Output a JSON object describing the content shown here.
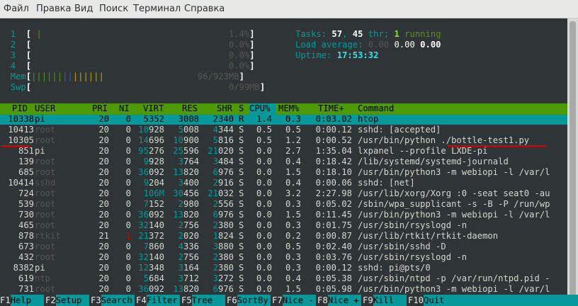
{
  "menu": [
    "Файл",
    "Правка",
    "Вид",
    "Поиск",
    "Терминал",
    "Справка"
  ],
  "cpus": [
    {
      "num": "1",
      "pct": "1.4%"
    },
    {
      "num": "2",
      "pct": "0.0%"
    },
    {
      "num": "3",
      "pct": "0.0%"
    },
    {
      "num": "4",
      "pct": "0.0%"
    }
  ],
  "mem": {
    "label": "Mem",
    "value": "96/923MB"
  },
  "swp": {
    "label": "Swp",
    "value": "0/99MB"
  },
  "summary": {
    "tasks_label": "Tasks:",
    "tasks": "57",
    "thr": "45",
    "thr_label": "thr;",
    "running": "1",
    "running_label": "running",
    "load_label": "Load average:",
    "load1": "0.00",
    "load5": "0.00",
    "load15": "0.00",
    "uptime_label": "Uptime:",
    "uptime": "17:53:32"
  },
  "columns": [
    "PID",
    "USER",
    "PRI",
    "NI",
    "VIRT",
    "RES",
    "SHR",
    "S",
    "CPU%",
    "MEM%",
    "TIME+",
    "Command"
  ],
  "processes": [
    {
      "pid": "10338",
      "user": "pi",
      "pri": "20",
      "ni": "0",
      "virt": "5352",
      "res": "3008",
      "shr": "2340",
      "s": "R",
      "cpu": "1.4",
      "mem": "0.3",
      "time": "0:03.02",
      "cmd": "htop"
    },
    {
      "pid": "10413",
      "user": "root",
      "pri": "20",
      "ni": "0",
      "virt": "10928",
      "res": "5008",
      "shr": "4344",
      "s": "S",
      "cpu": "0.5",
      "mem": "0.5",
      "time": "0:00.12",
      "cmd": "sshd: [accepted]"
    },
    {
      "pid": "10305",
      "user": "root",
      "pri": "20",
      "ni": "0",
      "virt": "14696",
      "res": "10900",
      "shr": "5816",
      "s": "S",
      "cpu": "0.5",
      "mem": "1.2",
      "time": "0:00.52",
      "cmd": "/usr/bin/python ./bottle-test1.py"
    },
    {
      "pid": "851",
      "user": "pi",
      "pri": "20",
      "ni": "0",
      "virt": "95276",
      "res": "25596",
      "shr": "21020",
      "s": "S",
      "cpu": "0.0",
      "mem": "2.7",
      "time": "1:35.04",
      "cmd": "lxpanel --profile LXDE-pi"
    },
    {
      "pid": "139",
      "user": "root",
      "pri": "20",
      "ni": "0",
      "virt": "9928",
      "res": "3764",
      "shr": "3484",
      "s": "S",
      "cpu": "0.0",
      "mem": "0.4",
      "time": "0:18.42",
      "cmd": "/lib/systemd/systemd-journald"
    },
    {
      "pid": "685",
      "user": "root",
      "pri": "20",
      "ni": "0",
      "virt": "36092",
      "res": "13820",
      "shr": "6976",
      "s": "S",
      "cpu": "0.0",
      "mem": "1.5",
      "time": "0:18.10",
      "cmd": "/usr/bin/python3 -m webiopi -l /var/l"
    },
    {
      "pid": "10414",
      "user": "sshd",
      "pri": "20",
      "ni": "0",
      "virt": "9204",
      "res": "3400",
      "shr": "2916",
      "s": "S",
      "cpu": "0.0",
      "mem": "0.4",
      "time": "0:00.06",
      "cmd": "sshd: [net]"
    },
    {
      "pid": "724",
      "user": "root",
      "pri": "20",
      "ni": "0",
      "virt": "106M",
      "res": "30456",
      "shr": "21032",
      "s": "S",
      "cpu": "0.0",
      "mem": "3.2",
      "time": "2:27.98",
      "cmd": "/usr/lib/xorg/Xorg :0 -seat seat0 -au"
    },
    {
      "pid": "539",
      "user": "root",
      "pri": "20",
      "ni": "0",
      "virt": "7152",
      "res": "2980",
      "shr": "2556",
      "s": "S",
      "cpu": "0.0",
      "mem": "0.3",
      "time": "0:05.02",
      "cmd": "/sbin/wpa_supplicant -s -B -P /run/wp"
    },
    {
      "pid": "730",
      "user": "root",
      "pri": "20",
      "ni": "0",
      "virt": "36092",
      "res": "13820",
      "shr": "6976",
      "s": "S",
      "cpu": "0.0",
      "mem": "1.5",
      "time": "0:11.45",
      "cmd": "/usr/bin/python3 -m webiopi -l /var/l"
    },
    {
      "pid": "465",
      "user": "root",
      "pri": "20",
      "ni": "0",
      "virt": "32140",
      "res": "2756",
      "shr": "2380",
      "s": "S",
      "cpu": "0.0",
      "mem": "0.3",
      "time": "0:01.75",
      "cmd": "/usr/sbin/rsyslogd -n"
    },
    {
      "pid": "878",
      "user": "rtkit",
      "pri": "21",
      "ni": "1",
      "virt": "21372",
      "res": "2020",
      "shr": "1824",
      "s": "S",
      "cpu": "0.0",
      "mem": "0.2",
      "time": "0:00.87",
      "cmd": "/usr/lib/rtkit/rtkit-daemon"
    },
    {
      "pid": "673",
      "user": "root",
      "pri": "20",
      "ni": "0",
      "virt": "7860",
      "res": "4336",
      "shr": "3880",
      "s": "S",
      "cpu": "0.0",
      "mem": "0.5",
      "time": "0:02.40",
      "cmd": "/usr/sbin/sshd -D"
    },
    {
      "pid": "432",
      "user": "root",
      "pri": "20",
      "ni": "0",
      "virt": "32140",
      "res": "2756",
      "shr": "2380",
      "s": "S",
      "cpu": "0.0",
      "mem": "0.3",
      "time": "0:03.76",
      "cmd": "/usr/sbin/rsyslogd -n"
    },
    {
      "pid": "8382",
      "user": "pi",
      "pri": "20",
      "ni": "0",
      "virt": "12348",
      "res": "3164",
      "shr": "2380",
      "s": "S",
      "cpu": "0.0",
      "mem": "0.3",
      "time": "0:00.12",
      "cmd": "sshd: pi@pts/0"
    },
    {
      "pid": "619",
      "user": "ntp",
      "pri": "20",
      "ni": "0",
      "virt": "5684",
      "res": "3712",
      "shr": "3272",
      "s": "S",
      "cpu": "0.0",
      "mem": "0.4",
      "time": "0:05.38",
      "cmd": "/usr/sbin/ntpd -p /var/run/ntpd.pid -"
    },
    {
      "pid": "731",
      "user": "root",
      "pri": "20",
      "ni": "0",
      "virt": "36092",
      "res": "13820",
      "shr": "6976",
      "s": "S",
      "cpu": "0.0",
      "mem": "1.5",
      "time": "0:05.98",
      "cmd": "/usr/bin/python3 -m webiopi -l /var/l"
    }
  ],
  "fkeys": [
    {
      "key": "F1",
      "label": "Help"
    },
    {
      "key": "F2",
      "label": "Setup"
    },
    {
      "key": "F3",
      "label": "Search"
    },
    {
      "key": "F4",
      "label": "Filter"
    },
    {
      "key": "F5",
      "label": "Tree"
    },
    {
      "key": "F6",
      "label": "SortBy"
    },
    {
      "key": "F7",
      "label": "Nice -"
    },
    {
      "key": "F8",
      "label": "Nice +"
    },
    {
      "key": "F9",
      "label": "Kill"
    },
    {
      "key": "F10",
      "label": "Quit"
    }
  ],
  "colors": {
    "header_bg": "#4e9a06",
    "selected_bg": "#06989a",
    "terminal_bg": "#2f3436"
  }
}
